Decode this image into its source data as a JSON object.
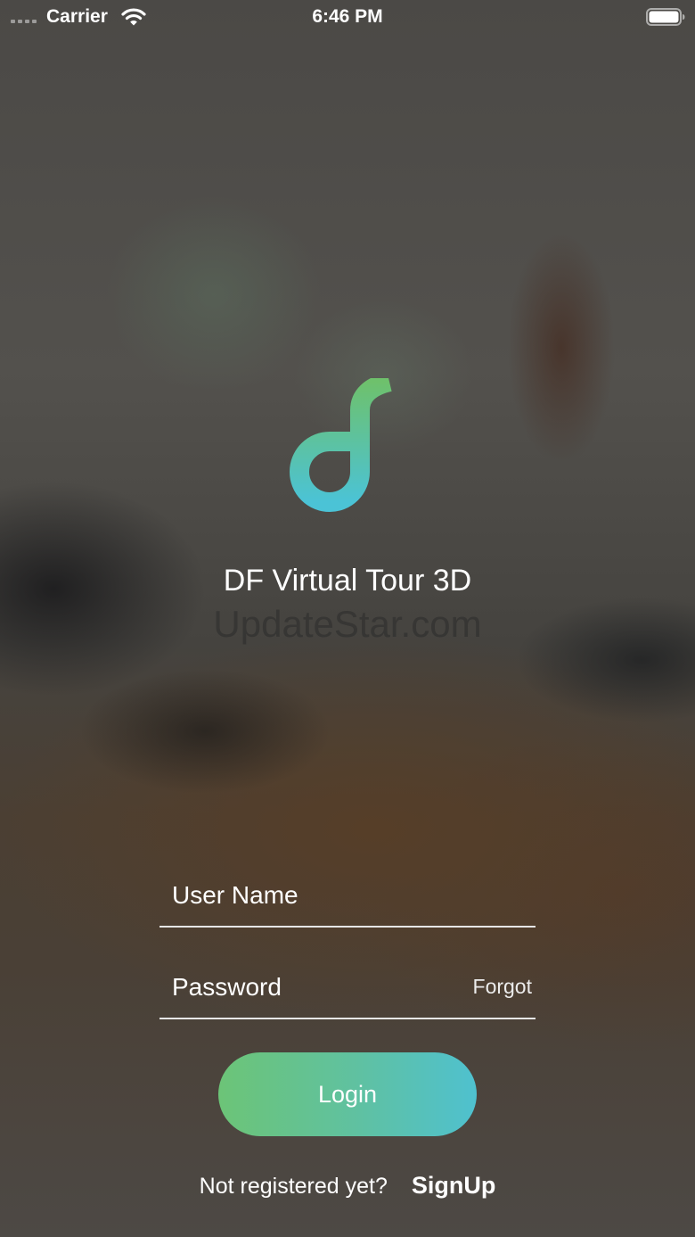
{
  "status_bar": {
    "carrier": "Carrier",
    "time": "6:46 PM",
    "icons": [
      "signal-dots-icon",
      "wifi-icon",
      "battery-icon"
    ]
  },
  "branding": {
    "logo": "df-logo",
    "title": "DF Virtual Tour 3D",
    "watermark": "UpdateStar.com"
  },
  "login_form": {
    "username_placeholder": "User Name",
    "password_placeholder": "Password",
    "forgot_label": "Forgot",
    "login_label": "Login",
    "signup_prompt": "Not registered yet?",
    "signup_label": "SignUp"
  },
  "colors": {
    "accent_start": "#6cc477",
    "accent_end": "#4fc1cf",
    "text": "#ffffff"
  }
}
